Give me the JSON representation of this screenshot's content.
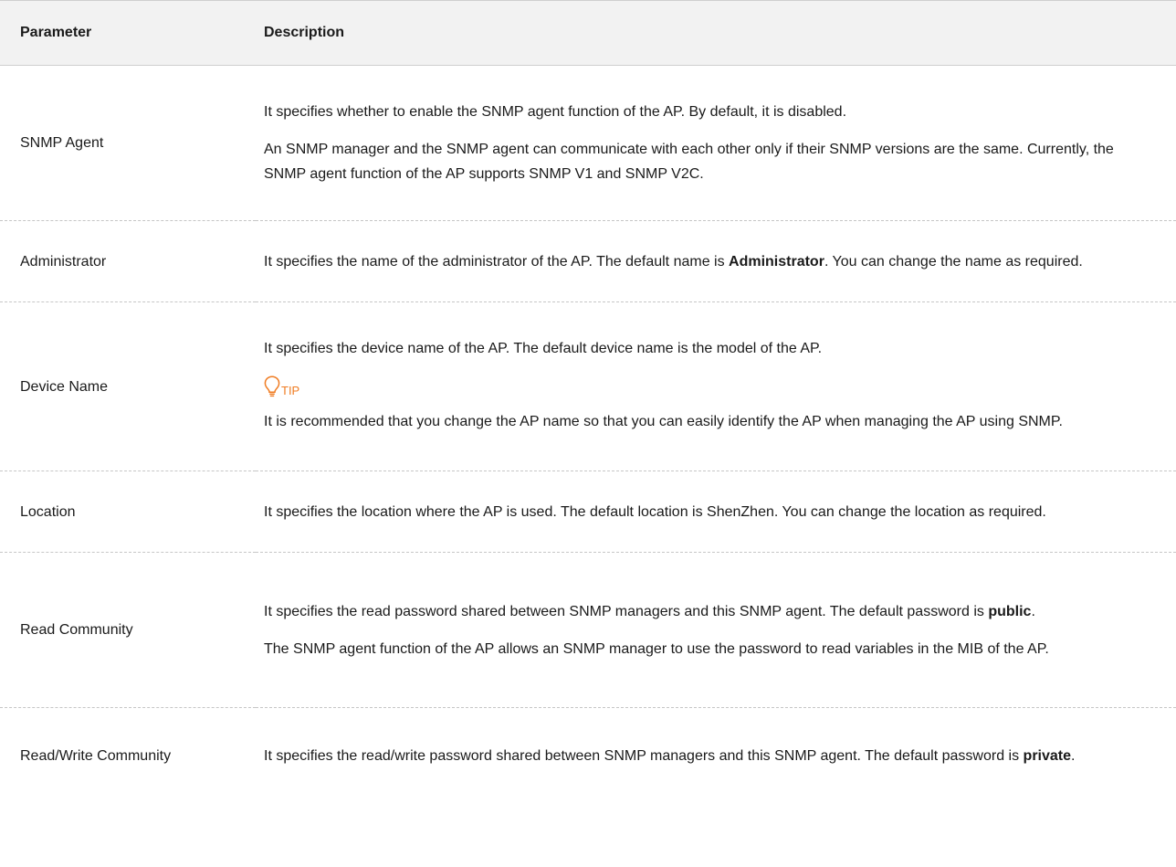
{
  "table": {
    "headers": {
      "parameter": "Parameter",
      "description": "Description"
    },
    "rows": {
      "snmp_agent": {
        "name": "SNMP Agent",
        "p1": "It specifies whether to enable the SNMP agent function of the AP. By default, it is disabled.",
        "p2": "An SNMP manager and the SNMP agent can communicate with each other only if their SNMP versions are the same. Currently, the SNMP agent function of the AP supports SNMP V1 and SNMP V2C."
      },
      "administrator": {
        "name": "Administrator",
        "p1_before": "It specifies the name of the administrator of the AP. The default name is ",
        "p1_bold": "Administrator",
        "p1_after": ". You can change the name as required."
      },
      "device_name": {
        "name": "Device Name",
        "p1": "It specifies the device name of the AP. The default device name is the model of the AP.",
        "tip_label": "TIP",
        "tip_text": "It is recommended that you change the AP name so that you can easily identify the AP when managing the AP using SNMP."
      },
      "location": {
        "name": "Location",
        "p1": "It specifies the location where the AP is used. The default location is ShenZhen. You can change the location as required."
      },
      "read_community": {
        "name": "Read Community",
        "p1_before": "It specifies the read password shared between SNMP managers and this SNMP agent. The default password is ",
        "p1_bold": "public",
        "p1_after": ".",
        "p2": "The SNMP agent function of the AP allows an SNMP manager to use the password to read variables in the MIB of the AP."
      },
      "read_write_community": {
        "name": "Read/Write Community",
        "p1_before": "It specifies the read/write password shared between SNMP managers and this SNMP agent. The default password is ",
        "p1_bold": "private",
        "p1_after": "."
      }
    }
  },
  "colors": {
    "header_bg": "#f2f2f2",
    "tip_orange": "#f07c22",
    "divider": "#c6c6c6"
  },
  "icons": {
    "tip": "lightbulb-icon"
  }
}
